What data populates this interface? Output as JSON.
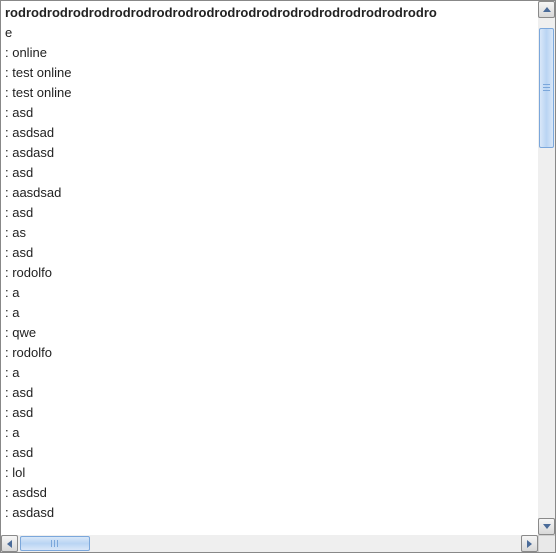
{
  "header_text": "rodrodrodrodrodrodrodrodrodrodrodrodrodrodrodrodrodrodrodrodro",
  "messages": [
    "e",
    ": online",
    ": test online",
    ": test online",
    ": asd",
    ": asdsad",
    ": asdasd",
    ": asd",
    ": aasdsad",
    ": asd",
    ": as",
    ": asd",
    ": rodolfo",
    ": a",
    ": a",
    ": qwe",
    ": rodolfo",
    ": a",
    ": asd",
    ": asd",
    ": a",
    ": asd",
    ": lol",
    ": asdsd",
    ": asdasd"
  ]
}
